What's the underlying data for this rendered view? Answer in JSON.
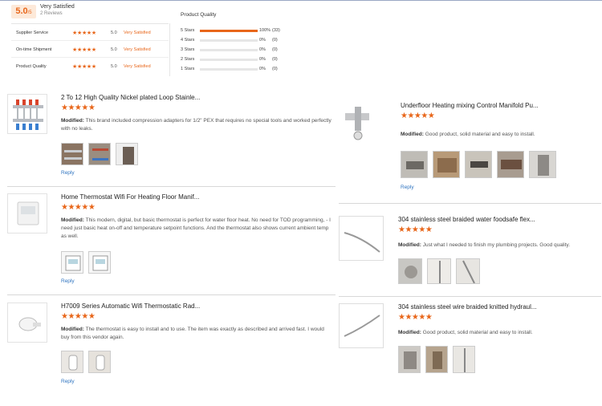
{
  "summary": {
    "score": "5.0",
    "score_suffix": "/5",
    "rating_word": "Very Satisfied",
    "reviews": "2 Reviews",
    "rows": [
      {
        "label": "Supplier Service",
        "value": "5.0",
        "word": "Very Satisfied"
      },
      {
        "label": "On-time Shipment",
        "value": "5.0",
        "word": "Very Satisfied"
      },
      {
        "label": "Product Quality",
        "value": "5.0",
        "word": "Very Satisfied"
      }
    ],
    "stars_glyph": "★★★★★"
  },
  "quality": {
    "title": "Product Quality",
    "rows": [
      {
        "label": "5 Stars",
        "pct": "100%",
        "count": "(33)",
        "fill": 1.0
      },
      {
        "label": "4 Stars",
        "pct": "0%",
        "count": "(0)",
        "fill": 0
      },
      {
        "label": "3 Stars",
        "pct": "0%",
        "count": "(0)",
        "fill": 0
      },
      {
        "label": "2 Stars",
        "pct": "0%",
        "count": "(0)",
        "fill": 0
      },
      {
        "label": "1 Stars",
        "pct": "0%",
        "count": "(0)",
        "fill": 0
      }
    ]
  },
  "reviews": [
    {
      "title": "2 To 12 High Quality Nickel plated Loop Stainle...",
      "rating": 5,
      "modified": "Modified:",
      "text": "This brand included compression adapters for 1/2\" PEX that requires no special tools and worked perfectly with no leaks.",
      "reply": "Reply"
    },
    {
      "title": "Home Thermostat Wifi For Heating Floor Manif...",
      "rating": 5,
      "modified": "Modified:",
      "text": "This modern, digital, but basic thermostat is perfect for water floor heat. No need for TOD programming, - I need just basic heat on-off and temperature setpoint functions. And the thermostat also shows current ambient temp as well.",
      "reply": "Reply"
    },
    {
      "title": "H7009 Series Automatic Wifi Thermostatic Rad...",
      "rating": 5,
      "modified": "Modified:",
      "text": "The thermostat is easy to install and to use. The item was exactly as described and arrived fast. I would buy from this vendor again.",
      "reply": "Reply"
    },
    {
      "title": "Underfloor Heating mixing Control Manifold Pu...",
      "rating": 5,
      "modified": "Modified:",
      "text": "Good product, solid material and easy to install.",
      "reply": "Reply"
    },
    {
      "title": "304 stainless steel braided water foodsafe flex...",
      "rating": 5,
      "modified": "Modified:",
      "text": "Just what I needed to finish my plumbing projects. Good quality.",
      "reply": ""
    },
    {
      "title": "304 stainless steel wire braided knitted hydraul...",
      "rating": 5,
      "modified": "Modified:",
      "text": "Good product, solid material and easy to install.",
      "reply": ""
    }
  ]
}
